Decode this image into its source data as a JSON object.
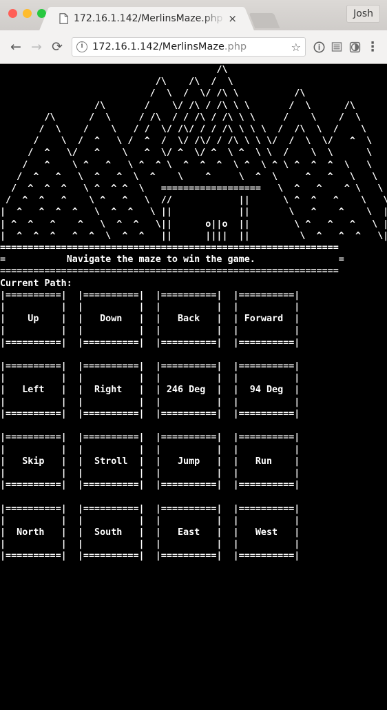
{
  "browser": {
    "window_controls": [
      "close",
      "minimize",
      "maximize"
    ],
    "tab": {
      "title": "172.16.1.142/MerlinsMaze.php",
      "close_label": "×",
      "page_icon": "page-icon"
    },
    "new_tab_label": "",
    "profile_label": "Josh",
    "toolbar": {
      "back_label": "←",
      "forward_label": "→",
      "reload_label": "⟳",
      "info_label": "i",
      "url_main": "172.16.1.142/MerlinsMaze",
      "url_suffix": ".php",
      "star_label": "☆",
      "page_info_label": "i",
      "reader_label": "☰",
      "shield_label": "◗",
      "menu_label": "⋮"
    }
  },
  "page": {
    "colors": {
      "background": "#000000",
      "foreground": "#ffffff"
    },
    "scene_art": "                                       /\\\n                            /\\    /\\  /  \\\n                           /  \\  /  \\/ /\\ \\          /\\\n                 /\\       /    \\/ /\\ / /\\ \\ \\       /  \\      /\\\n        /\\      /  \\     / /\\  / / /\\ / /\\ \\ \\     /    \\    /  \\\n       /  \\    /    \\   / /  \\/ /\\/ / / /\\ \\ \\ \\  /  /\\  \\  /    \\\n      /    \\  /  ^   \\ /  ^  /  \\/ /\\/ / /\\ \\ \\ \\/  /  \\  \\/   ^  \\\n     /  ^   \\/   ^    \\   ^  \\/ ^  \\/ ^  \\ ^  \\ \\  /    \\  \\      \\\n    /   ^    \\ ^   ^   \\ ^  ^ \\  ^  ^  ^  \\ ^  \\ ^ \\ ^  ^  ^  \\   \\\n   /  ^   ^   \\  ^   ^  \\  ^    \\    ^     \\  ^  \\     ^   ^   \\   \\\n  /  ^  ^  ^   \\ ^  ^ ^  \\   ==================   \\  ^   ^    ^ \\   \\\n /  ^  ^   ^    \\ ^   ^   \\  //            ||      \\ ^  ^   ^    \\   \\\n|  ^   ^  ^  ^   \\  ^  ^   \\ ||            ||       \\   ^    ^    \\  |\n| ^  ^   ^    ^   \\  ^  ^   \\||      o||o  ||        \\ ^   ^   ^   \\ |\n|  ^  ^  ^   ^  ^  \\  ^  ^   ||      ||||  ||         \\  ^   ^  ^   \\|",
    "banner_top": "=============================================================",
    "banner_text": "=           Navigate the maze to win the game.               =",
    "banner_bottom": "=============================================================",
    "path_label": "Current Path:",
    "buttons": [
      [
        {
          "label": "Up",
          "name": "up"
        },
        {
          "label": "Down",
          "name": "down"
        },
        {
          "label": "Back",
          "name": "back"
        },
        {
          "label": "Forward",
          "name": "forward"
        }
      ],
      [
        {
          "label": "Left",
          "name": "left"
        },
        {
          "label": "Right",
          "name": "right"
        },
        {
          "label": "246 Deg",
          "name": "246-deg"
        },
        {
          "label": "94 Deg",
          "name": "94-deg"
        }
      ],
      [
        {
          "label": "Skip",
          "name": "skip"
        },
        {
          "label": "Stroll",
          "name": "stroll"
        },
        {
          "label": "Jump",
          "name": "jump"
        },
        {
          "label": "Run",
          "name": "run"
        }
      ],
      [
        {
          "label": "North",
          "name": "north"
        },
        {
          "label": "South",
          "name": "south"
        },
        {
          "label": "East",
          "name": "east"
        },
        {
          "label": "West",
          "name": "west"
        }
      ]
    ],
    "button_box": {
      "top_rule": "|==========|",
      "side_rule": "|          |",
      "bottom_rule": "|==========|"
    }
  }
}
